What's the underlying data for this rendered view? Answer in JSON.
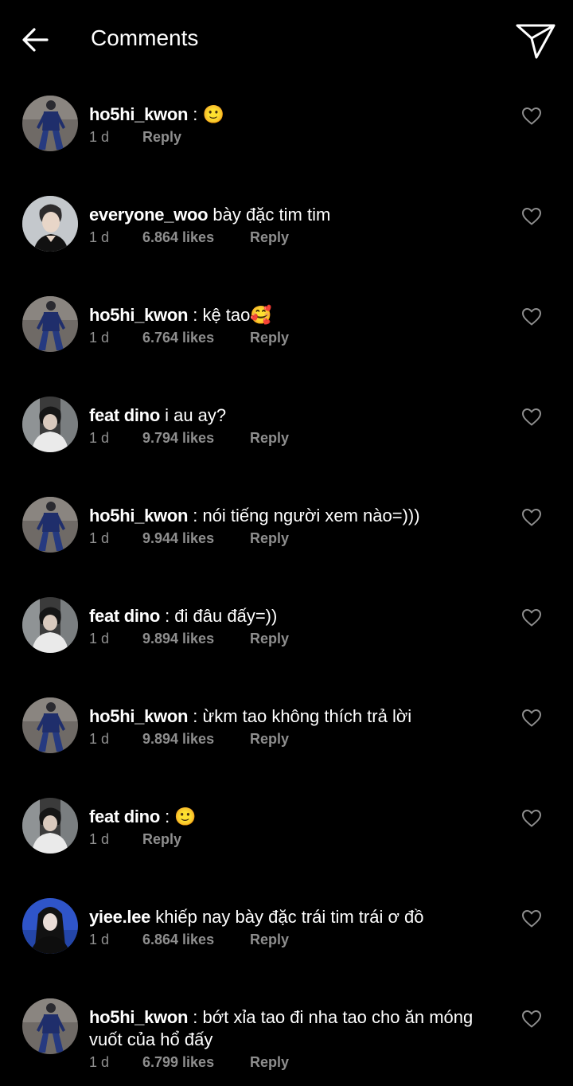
{
  "header": {
    "title": "Comments",
    "back_icon": "arrow-left-icon",
    "send_icon": "paper-plane-icon"
  },
  "comments": [
    {
      "username": "ho5hi_kwon",
      "text": " : 🙂",
      "time": "1 d",
      "likes": "",
      "reply": "Reply",
      "avatar": "tall-figure-suit"
    },
    {
      "username": "everyone_woo",
      "text": " bày đặc tim tim",
      "time": "1 d",
      "likes": "6.864 likes",
      "reply": "Reply",
      "avatar": "portrait-man"
    },
    {
      "username": "ho5hi_kwon",
      "text": " : kệ tao🥰",
      "time": "1 d",
      "likes": "6.764 likes",
      "reply": "Reply",
      "avatar": "tall-figure-suit"
    },
    {
      "username": "feat dino",
      "text": " i au ay?",
      "time": "1 d",
      "likes": "9.794 likes",
      "reply": "Reply",
      "avatar": "boy-white-shirt"
    },
    {
      "username": "ho5hi_kwon",
      "text": " : nói tiếng người xem nào=)))",
      "time": "1 d",
      "likes": "9.944 likes",
      "reply": "Reply",
      "avatar": "tall-figure-suit"
    },
    {
      "username": "feat dino",
      "text": " : đi đâu đấy=))",
      "time": "1 d",
      "likes": "9.894 likes",
      "reply": "Reply",
      "avatar": "boy-white-shirt"
    },
    {
      "username": "ho5hi_kwon",
      "text": " : ừkm tao không thích trả lời",
      "time": "1 d",
      "likes": "9.894 likes",
      "reply": "Reply",
      "avatar": "tall-figure-suit"
    },
    {
      "username": "feat dino",
      "text": " : 🙂",
      "time": "1 d",
      "likes": "",
      "reply": "Reply",
      "avatar": "boy-white-shirt"
    },
    {
      "username": "yiee.lee",
      "text": " khiếp nay bày đặc trái tim trái ơ đồ",
      "time": "1 d",
      "likes": "6.864 likes",
      "reply": "Reply",
      "avatar": "girl-blue-background"
    },
    {
      "username": "ho5hi_kwon",
      "text": " : bớt xỉa tao đi nha tao cho ăn móng vuốt của hổ đấy",
      "time": "1 d",
      "likes": "6.799 likes",
      "reply": "Reply",
      "avatar": "tall-figure-suit"
    }
  ],
  "colors": {
    "background": "#000000",
    "text": "#ffffff",
    "meta": "#8e8e8e"
  }
}
